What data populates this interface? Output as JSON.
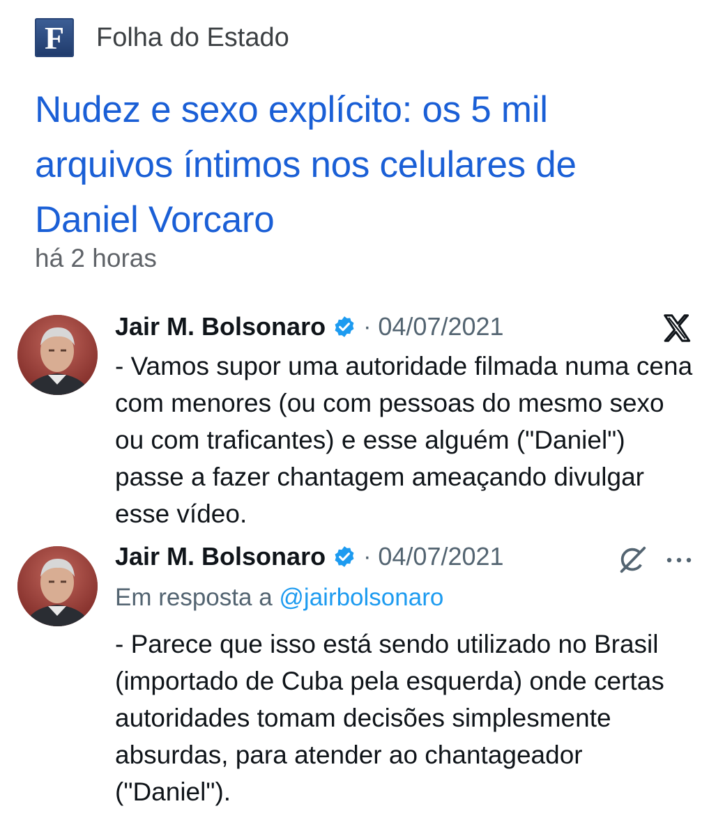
{
  "news": {
    "logo_letter": "F",
    "source": "Folha do Estado",
    "headline": "Nudez e sexo explícito: os 5 mil arquivos íntimos nos celulares de Daniel Vorcaro",
    "time": "há 2 horas",
    "headline_color": "#1a5fd6"
  },
  "tweets": [
    {
      "name": "Jair M. Bolsonaro",
      "separator": "·",
      "date": "04/07/2021",
      "text": "- Vamos supor uma autoridade filmada numa cena com menores (ou com pessoas do mesmo sexo ou com traficantes) e esse alguém (\"Daniel\") passe a fazer chantagem ameaçando divulgar esse vídeo.",
      "icon": "x-logo-icon"
    },
    {
      "name": "Jair M. Bolsonaro",
      "separator": "·",
      "date": "04/07/2021",
      "reply_prefix": "Em resposta a",
      "reply_handle": "@jairbolsonaro",
      "text": "- Parece que isso está sendo utilizado no Brasil (importado de Cuba pela esquerda) onde certas autoridades tomam decisões simplesmente absurdas, para atender ao chantageador  (\"Daniel\").",
      "icons": [
        "grok-icon",
        "more-icon"
      ]
    }
  ],
  "colors": {
    "verified": "#1d9bf0",
    "muted": "#536471",
    "link": "#1d9bf0"
  }
}
